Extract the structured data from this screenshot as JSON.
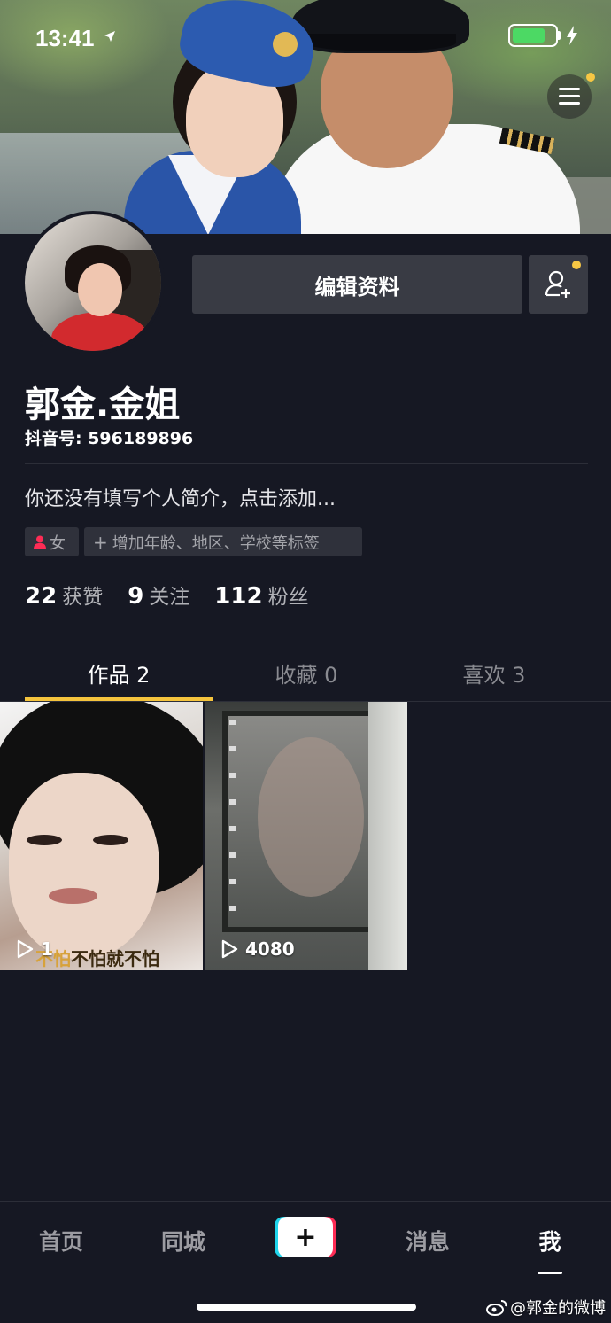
{
  "status_bar": {
    "time": "13:41",
    "battery_level": 0.75,
    "charging": true
  },
  "profile": {
    "edit_label": "编辑资料",
    "nickname": "郭金.金姐",
    "douyin_id": "抖音号: 596189896",
    "bio": "你还没有填写个人简介，点击添加...",
    "gender_tag": "女",
    "add_tags": "增加年龄、地区、学校等标签",
    "stats": [
      {
        "num": "22",
        "label": "获赞"
      },
      {
        "num": "9",
        "label": "关注"
      },
      {
        "num": "112",
        "label": "粉丝"
      }
    ]
  },
  "tabs": [
    {
      "label": "作品 2",
      "active": true
    },
    {
      "label": "收藏 0",
      "active": false
    },
    {
      "label": "喜欢 3",
      "active": false
    }
  ],
  "videos": [
    {
      "plays": "1",
      "subtitle_highlight": "不怕",
      "subtitle_rest": "不怕就不怕"
    },
    {
      "plays": "4080"
    }
  ],
  "bottom_nav": {
    "home": "首页",
    "nearby": "同城",
    "create": "+",
    "messages": "消息",
    "me": "我"
  },
  "watermark": "@郭金的微博",
  "colors": {
    "background": "#161823",
    "accent_yellow": "#f5c43d",
    "button_bg": "#393b44",
    "tiktok_cyan": "#20d5ec",
    "tiktok_red": "#fe2c55"
  }
}
